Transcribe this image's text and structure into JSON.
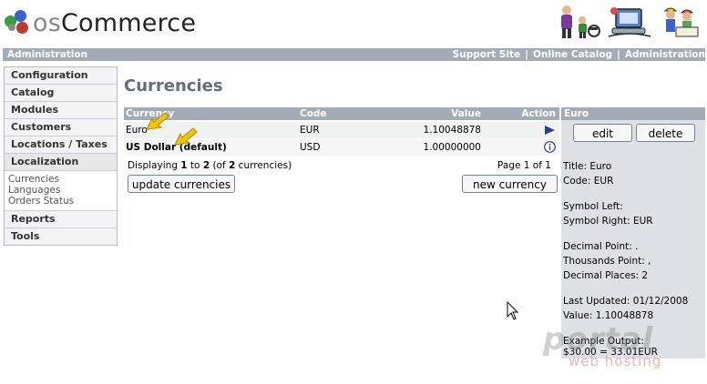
{
  "brand": {
    "logo_os": "os",
    "logo_rest": "Commerce"
  },
  "topbar": {
    "left": "Administration",
    "links": [
      "Support Site",
      "Online Catalog",
      "Administration"
    ],
    "separator": "|"
  },
  "sidebar": {
    "sections": [
      "Configuration",
      "Catalog",
      "Modules",
      "Customers",
      "Locations / Taxes",
      "Localization",
      "Reports",
      "Tools"
    ],
    "localization_items": [
      "Currencies",
      "Languages",
      "Orders Status"
    ]
  },
  "page": {
    "title": "Currencies"
  },
  "table": {
    "headers": {
      "currency": "Currency",
      "code": "Code",
      "value": "Value",
      "action": "Action"
    },
    "rows": [
      {
        "currency": "Euro",
        "code": "EUR",
        "value": "1.10048878",
        "action_icon": "play-arrow-icon"
      },
      {
        "currency": "US Dollar (default)",
        "code": "USD",
        "value": "1.00000000",
        "action_icon": "info-icon"
      }
    ],
    "display": {
      "pre": "Displaying ",
      "from": "1",
      "mid1": " to ",
      "to": "2",
      "mid2": " (of ",
      "total": "2",
      "post": " currencies)"
    },
    "page_info": "Page 1 of 1",
    "update_button": "update currencies",
    "new_button": "new currency"
  },
  "detail": {
    "heading": "Euro",
    "edit_button": "edit",
    "delete_button": "delete",
    "title": "Title: Euro",
    "code": "Code: EUR",
    "symbol_left": "Symbol Left:",
    "symbol_right": "Symbol Right: EUR",
    "decimal_point": "Decimal Point: .",
    "thousands_point": "Thousands Point: ,",
    "decimal_places": "Decimal Places: 2",
    "last_updated": "Last Updated: 01/12/2008",
    "value": "Value: 1.10048878",
    "example_label": "Example Output:",
    "example_value": "$30.00 = 33.01EUR"
  },
  "watermark": {
    "main": "portal",
    "sub": "web hosting"
  },
  "colors": {
    "bar": "#a5abb6",
    "title": "#616f7c",
    "panel": "#dde0e5",
    "accent_arrow": "#f5c400"
  }
}
